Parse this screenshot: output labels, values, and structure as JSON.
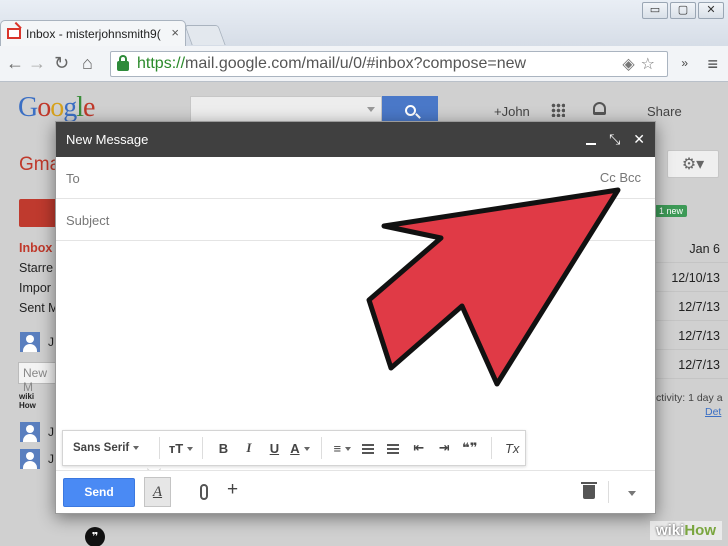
{
  "browser": {
    "tab_title": "Inbox - misterjohnsmith9(",
    "tab_close": "×",
    "window_buttons": [
      "▭",
      "▢",
      "✕"
    ],
    "url_scheme": "https://",
    "url_rest": "mail.google.com/mail/u/0/#inbox?compose=new",
    "nav": {
      "back": "←",
      "forward": "→",
      "reload": "↻",
      "home": "⌂"
    },
    "omnibox_icons": "◈☆",
    "extensions": "»",
    "menu": "≡"
  },
  "gmail": {
    "logo": [
      "G",
      "o",
      "o",
      "g",
      "l",
      "e"
    ],
    "label": "Gma",
    "user": "+John",
    "share": "Share",
    "settings_icon": "gear-icon",
    "nav_items": [
      {
        "label": "Inbox",
        "active": true
      },
      {
        "label": "Starre",
        "active": false
      },
      {
        "label": "Impor",
        "active": false
      },
      {
        "label": "Sent M",
        "active": false
      }
    ],
    "new_badge": "1 new",
    "dates": [
      "Jan 6",
      "12/10/13",
      "12/7/13",
      "12/7/13",
      "12/7/13"
    ],
    "activity": "ctivity: 1 day a",
    "activity_details": "Det",
    "side_contact_initial": "J",
    "side_new": "New M",
    "wiki_small": [
      "wiki",
      "How"
    ]
  },
  "compose": {
    "title": "New Message",
    "header_buttons": {
      "minimize": "",
      "expand": "⤡",
      "close": "✕"
    },
    "to_label": "To",
    "cc_bcc": "Cc  Bcc",
    "subject_label": "Subject",
    "format_bar": {
      "font": "Sans Serif",
      "size": "тT",
      "bold": "B",
      "italic": "I",
      "underline": "U",
      "text_color": "A",
      "align": "≡",
      "numbered": "⅓≡",
      "bulleted": "•≡",
      "indent_less": "⇤",
      "indent_more": "⇥",
      "quote": "❝❞",
      "remove_format": "Tx"
    },
    "footer": {
      "send": "Send",
      "formatting_toggle": "A",
      "attach_icon": "paperclip-icon",
      "add": "+",
      "discard_icon": "trash-icon"
    }
  },
  "overlay": {
    "arrow_color": "#e03a46"
  },
  "watermark": {
    "wiki": "wiki",
    "how": "How"
  }
}
